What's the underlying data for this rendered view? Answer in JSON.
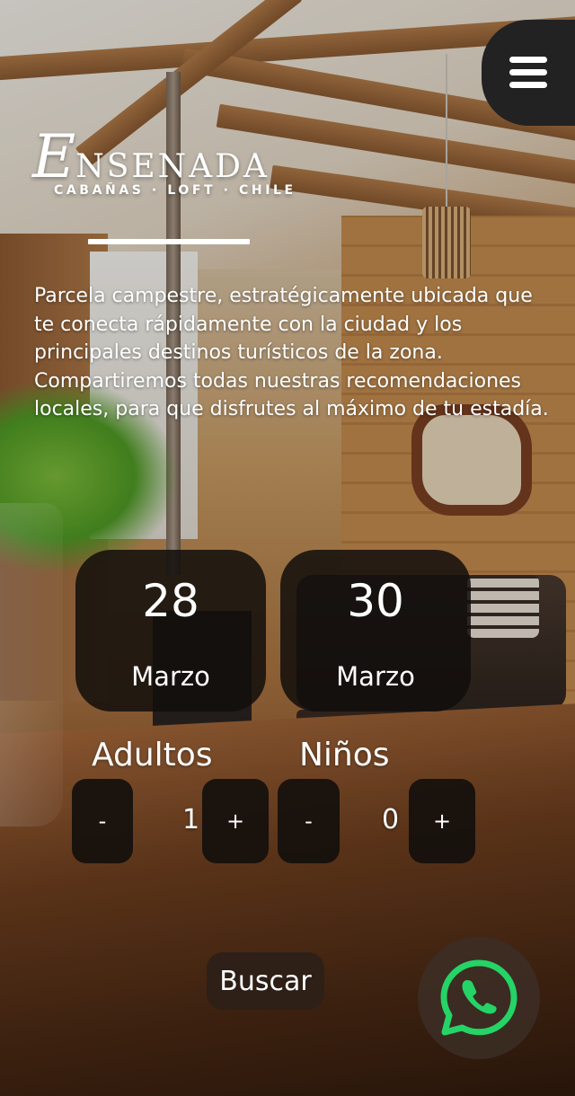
{
  "header": {
    "menu_icon": "hamburger-menu-icon"
  },
  "logo": {
    "initial": "E",
    "rest": "NSENADA",
    "tagline": "CABAÑAS · LOFT · CHILE"
  },
  "intro": {
    "text": "Parcela campestre, estratégicamente ubicada que te conecta rápidamente con la ciudad y los principales destinos turísticos de la zona. Compartiremos todas nuestras recomendaciones locales, para que disfrutes al máximo de tu estadía."
  },
  "booking": {
    "checkin": {
      "day": "28",
      "month": "Marzo"
    },
    "checkout": {
      "day": "30",
      "month": "Marzo"
    },
    "adults": {
      "label": "Adultos",
      "minus": "-",
      "value": "1",
      "plus": "+"
    },
    "kids": {
      "label": "Niños",
      "minus": "-",
      "value": "0",
      "plus": "+"
    },
    "search_label": "Buscar"
  },
  "whatsapp": {
    "icon": "whatsapp-icon",
    "color": "#25d366"
  }
}
